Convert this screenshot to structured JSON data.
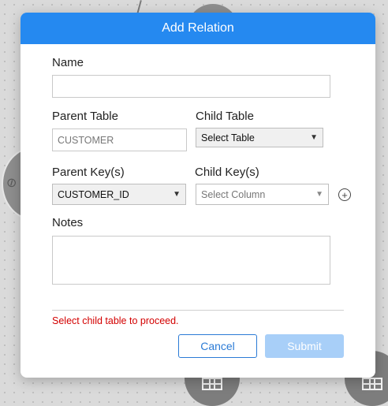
{
  "dialog": {
    "title": "Add Relation",
    "name_label": "Name",
    "name_value": "",
    "parent_table_label": "Parent Table",
    "parent_table_value": "CUSTOMER",
    "child_table_label": "Child Table",
    "child_table_value": "Select Table",
    "parent_keys_label": "Parent Key(s)",
    "parent_key_value": "CUSTOMER_ID",
    "child_keys_label": "Child Key(s)",
    "child_key_value": "Select Column",
    "add_key_icon": "+",
    "notes_label": "Notes",
    "notes_value": "",
    "error_message": "Select child table to proceed.",
    "cancel_label": "Cancel",
    "submit_label": "Submit"
  },
  "colors": {
    "header": "#2589f0",
    "error": "#d30000",
    "submit_disabled": "#a8cff8",
    "cancel_border": "#2b7bd6"
  },
  "icons": {
    "caret": "chevron-down-icon",
    "add": "plus-circle-icon"
  }
}
